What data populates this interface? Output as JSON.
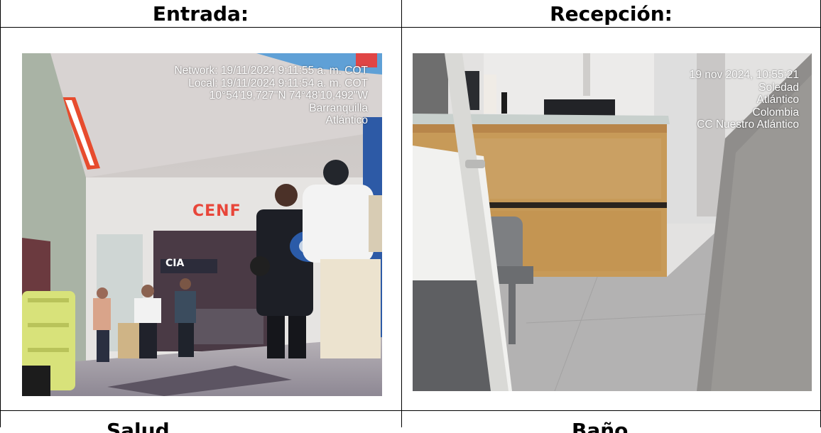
{
  "table": {
    "columns": [
      {
        "header": "Entrada:",
        "photo": {
          "overlay_lines": [
            "Network: 19/11/2024 9:11:55 a. m. COT",
            "Local: 19/11/2024 9:11:54 a. m. COT",
            "10°54'19,727\"N 74°48'10,492\"W",
            "Barranquilla",
            "Atlántico"
          ],
          "sign_text": "CENF",
          "sign_text_2": "CIA"
        }
      },
      {
        "header": "Recepción:",
        "photo": {
          "overlay_lines": [
            "19 nov 2024, 10:55:21",
            "Soledad",
            "Atlántico",
            "Colombia",
            "CC Nuestro Atlántico"
          ]
        }
      }
    ],
    "next_row_headers": [
      "Salud",
      "Baño"
    ]
  }
}
